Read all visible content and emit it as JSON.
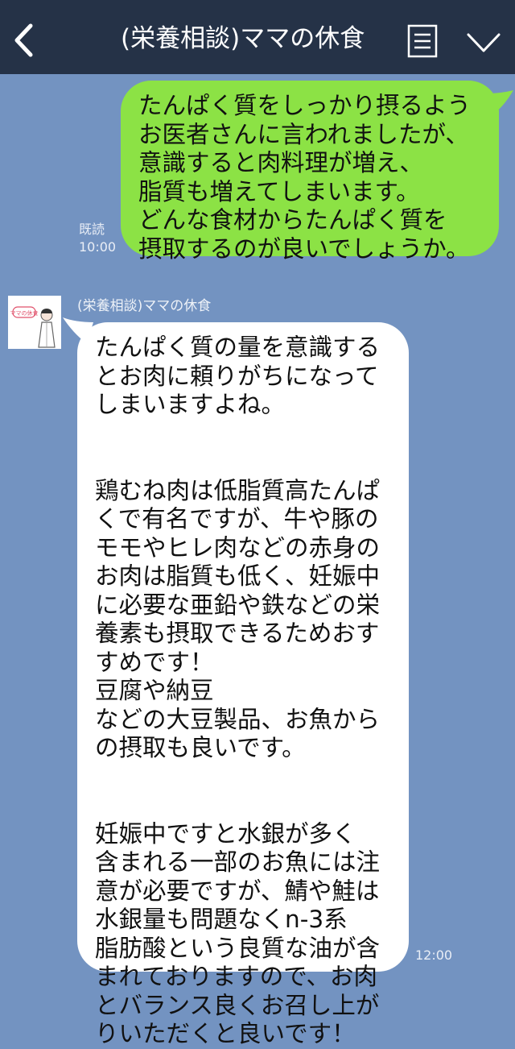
{
  "header": {
    "title": "(栄養相談)ママの休食"
  },
  "messages": [
    {
      "type": "sent",
      "text": "たんぱく質をしっかり摂るよう\nお医者さんに言われましたが、\n意識すると肉料理が増え、\n脂質も増えてしまいます。\nどんな食材からたんぱく質を\n摂取するのが良いでしょうか。",
      "read_label": "既読",
      "time": "10:00"
    },
    {
      "type": "received",
      "sender": "(栄養相談)ママの休食",
      "avatar_text": "ママの休食",
      "text": "たんぱく質の量を意識する\nとお肉に頼りがちになって\nしまいますよね。\n\n\n鶏むね肉は低脂質高たんぱ\nくで有名ですが、牛や豚の\nモモやヒレ肉などの赤身の\nお肉は脂質も低く、妊娠中\nに必要な亜鉛や鉄などの栄\n養素も摂取できるためおす\nすめです！\n豆腐や納豆\nなどの大豆製品、お魚から\nの摂取も良いです。\n\n\n妊娠中ですと水銀が多く\n含まれる一部のお魚には注\n意が必要ですが、鯖や鮭は\n水銀量も問題なくn-3系\n脂肪酸という良質な油が含\nまれておりますので、お肉\nとバランス良くお召し上が\nりいただくと良いです！",
      "time": "12:00"
    }
  ],
  "colors": {
    "header_bg": "#253247",
    "chat_bg": "#7393c1",
    "sent_bubble": "#8ce245",
    "received_bubble": "#ffffff",
    "avatar_accent": "#e0506a"
  },
  "icons": {
    "back": "chevron-left-icon",
    "menu": "menu-icon",
    "collapse": "chevron-down-icon"
  }
}
